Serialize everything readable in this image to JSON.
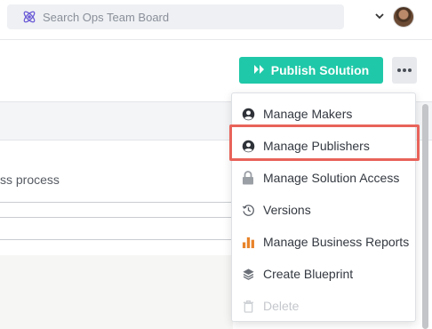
{
  "search": {
    "placeholder": "Search Ops Team Board",
    "icon": "atom-icon"
  },
  "header": {
    "dropdown_icon": "chevron-down-icon",
    "avatar_icon": "user-avatar"
  },
  "toolbar": {
    "publish_label": "Publish Solution",
    "publish_icon": "double-chevron-right-icon",
    "more_icon": "more-dots-icon"
  },
  "background": {
    "partial_text": "ss process"
  },
  "menu": {
    "items": [
      {
        "label": "Manage Makers",
        "icon": "user-circle-icon",
        "enabled": true
      },
      {
        "label": "Manage Publishers",
        "icon": "user-circle-icon",
        "enabled": true,
        "highlighted": true
      },
      {
        "label": "Manage Solution Access",
        "icon": "lock-icon",
        "enabled": true
      },
      {
        "label": "Versions",
        "icon": "history-icon",
        "enabled": true
      },
      {
        "label": "Manage Business Reports",
        "icon": "bar-chart-icon",
        "enabled": true
      },
      {
        "label": "Create Blueprint",
        "icon": "layers-icon",
        "enabled": true
      },
      {
        "label": "Delete",
        "icon": "trash-icon",
        "enabled": false
      }
    ]
  },
  "colors": {
    "accent": "#1fc8a8",
    "highlight": "#e8635a",
    "search_icon": "#6b5bd6",
    "report_icon": "#e8832a"
  }
}
